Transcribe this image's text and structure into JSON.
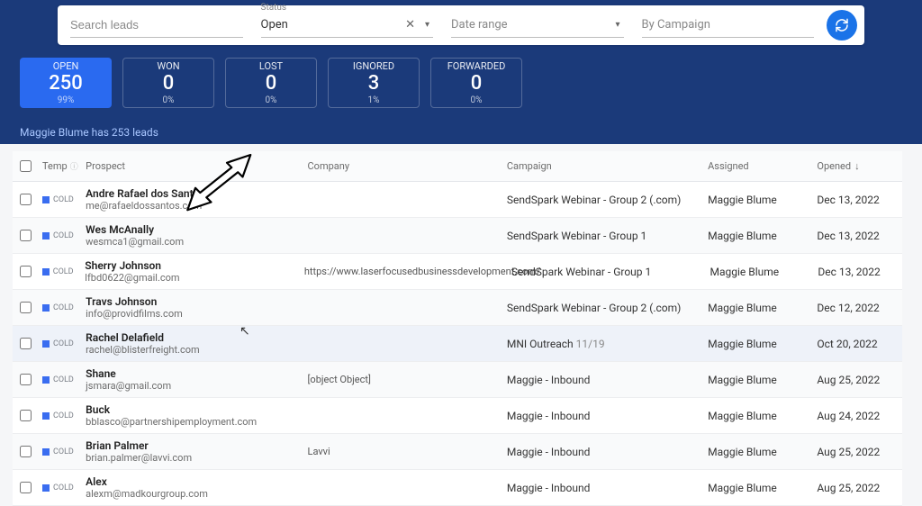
{
  "filters": {
    "search_placeholder": "Search leads",
    "status_label": "Status",
    "status_value": "Open",
    "date_placeholder": "Date range",
    "campaign_placeholder": "By Campaign"
  },
  "stats": [
    {
      "label": "OPEN",
      "value": "250",
      "pct": "99%",
      "active": true
    },
    {
      "label": "WON",
      "value": "0",
      "pct": "0%",
      "active": false
    },
    {
      "label": "LOST",
      "value": "0",
      "pct": "0%",
      "active": false
    },
    {
      "label": "IGNORED",
      "value": "3",
      "pct": "1%",
      "active": false
    },
    {
      "label": "FORWARDED",
      "value": "0",
      "pct": "0%",
      "active": false
    }
  ],
  "leads_summary": "Maggie Blume has 253 leads",
  "columns": {
    "temp": "Temp",
    "prospect": "Prospect",
    "company": "Company",
    "campaign": "Campaign",
    "assigned": "Assigned",
    "opened": "Opened"
  },
  "rows": [
    {
      "temp": "COLD",
      "name": "Andre Rafael dos Santos",
      "email": "me@rafaeldossantos.com",
      "company": "",
      "campaign": "SendSpark Webinar - Group 2 (.com)",
      "assigned": "Maggie Blume",
      "opened": "Dec 13, 2022"
    },
    {
      "temp": "COLD",
      "name": "Wes McAnally",
      "email": "wesmca1@gmail.com",
      "company": "",
      "campaign": "SendSpark Webinar - Group 1",
      "assigned": "Maggie Blume",
      "opened": "Dec 13, 2022"
    },
    {
      "temp": "COLD",
      "name": "Sherry Johnson",
      "email": "lfbd0622@gmail.com",
      "company": "https://www.laserfocusedbusinessdevelopment.com/",
      "campaign": "SendSpark Webinar - Group 1",
      "assigned": "Maggie Blume",
      "opened": "Dec 13, 2022"
    },
    {
      "temp": "COLD",
      "name": "Travs Johnson",
      "email": "info@providfilms.com",
      "company": "",
      "campaign": "SendSpark Webinar - Group 2 (.com)",
      "assigned": "Maggie Blume",
      "opened": "Dec 12, 2022"
    },
    {
      "temp": "COLD",
      "name": "Rachel Delafield",
      "email": "rachel@blisterfreight.com",
      "company": "",
      "campaign": "MNI Outreach 11/19",
      "campaign_suffix": "",
      "assigned": "Maggie Blume",
      "opened": "Oct 20, 2022",
      "highlight": true
    },
    {
      "temp": "COLD",
      "name": "Shane",
      "email": "jsmara@gmail.com",
      "company": "[object Object]",
      "campaign": "Maggie - Inbound",
      "assigned": "Maggie Blume",
      "opened": "Aug 25, 2022"
    },
    {
      "temp": "COLD",
      "name": "Buck",
      "email": "bblasco@partnershipemployment.com",
      "company": "",
      "campaign": "Maggie - Inbound",
      "assigned": "Maggie Blume",
      "opened": "Aug 24, 2022"
    },
    {
      "temp": "COLD",
      "name": "Brian Palmer",
      "email": "brian.palmer@lavvi.com",
      "company": "Lavvi",
      "campaign": "Maggie - Inbound",
      "assigned": "Maggie Blume",
      "opened": "Aug 25, 2022"
    },
    {
      "temp": "COLD",
      "name": "Alex",
      "email": "alexm@madkourgroup.com",
      "company": "",
      "campaign": "Maggie - Inbound",
      "assigned": "Maggie Blume",
      "opened": "Aug 25, 2022"
    }
  ]
}
